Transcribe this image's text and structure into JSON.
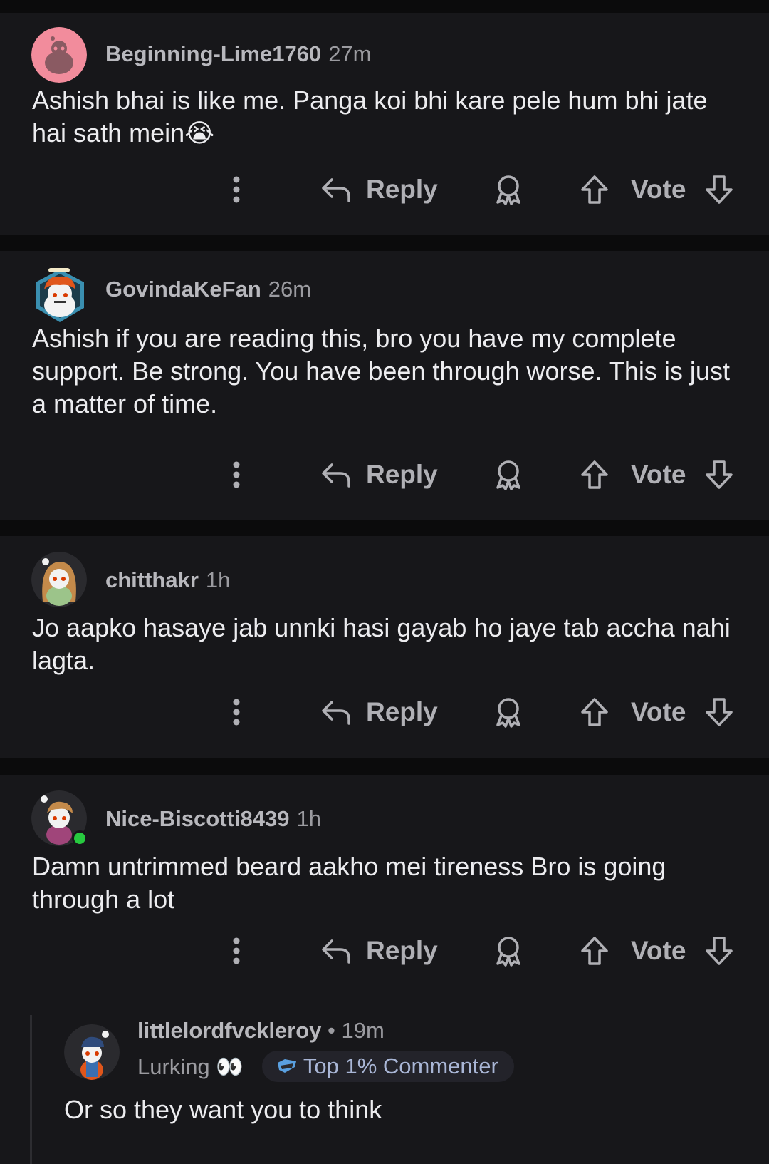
{
  "comments": [
    {
      "username": "Beginning-Lime1760",
      "time": "27m",
      "text": "Ashish bhai is like me. Panga koi bhi kare pele hum bhi jate hai sath mein😭",
      "reply_label": "Reply",
      "vote_label": "Vote"
    },
    {
      "username": "GovindaKeFan",
      "time": "26m",
      "text": "Ashish if you are reading this, bro you have my complete support. Be strong. You have been through worse. This is just a matter of time.",
      "reply_label": "Reply",
      "vote_label": "Vote"
    },
    {
      "username": "chitthakr",
      "time": "1h",
      "text": "Jo aapko hasaye jab unnki hasi gayab ho jaye tab accha nahi lagta.",
      "reply_label": "Reply",
      "vote_label": "Vote"
    },
    {
      "username": "Nice-Biscotti8439",
      "time": "1h",
      "text": "Damn untrimmed beard aakho mei tireness Bro is going through a lot",
      "reply_label": "Reply",
      "vote_label": "Vote"
    }
  ],
  "reply": {
    "username": "littlelordfvckleroy",
    "separator": "•",
    "time": "19m",
    "flair": "Lurking 👀",
    "badge": "Top 1% Commenter",
    "text": "Or so they want you to think"
  },
  "colors": {
    "background": "#0b0b0c",
    "card": "#17171a",
    "muted_text": "#9b9ba0",
    "body_text": "#ececef",
    "online_dot": "#27c93f"
  },
  "icons": [
    "more-vertical-icon",
    "reply-arrow-icon",
    "award-icon",
    "upvote-arrow-icon",
    "downvote-arrow-icon",
    "top-commenter-icon"
  ]
}
